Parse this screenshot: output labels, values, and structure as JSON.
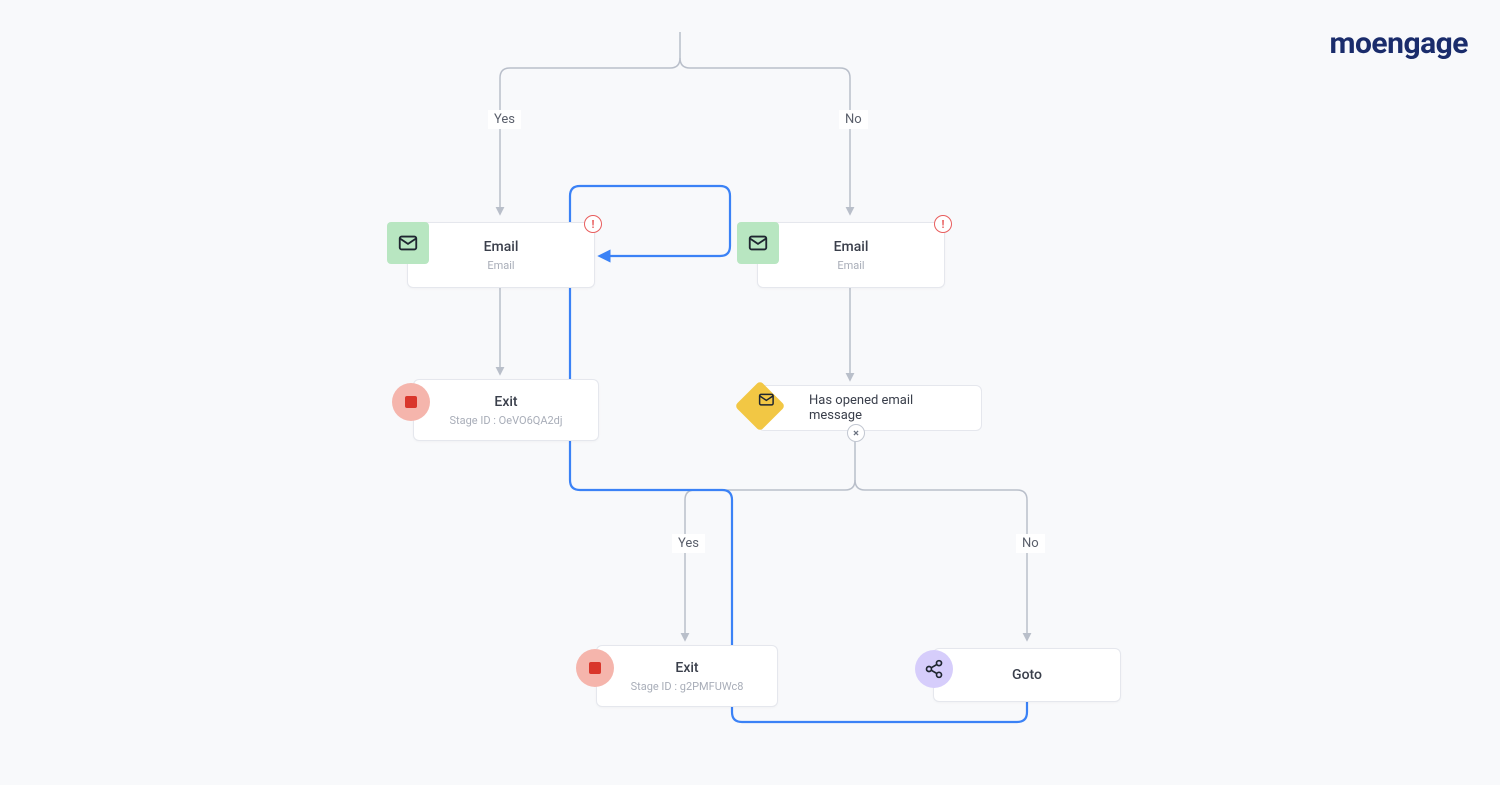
{
  "brand": "moengage",
  "branch1": {
    "yes": "Yes",
    "no": "No"
  },
  "branch2": {
    "yes": "Yes",
    "no": "No"
  },
  "email_left": {
    "title": "Email",
    "sub": "Email"
  },
  "email_right": {
    "title": "Email",
    "sub": "Email"
  },
  "exit_left": {
    "title": "Exit",
    "sub": "Stage ID : OeVO6QA2dj"
  },
  "condition": {
    "title": "Has opened email message"
  },
  "exit_bottom": {
    "title": "Exit",
    "sub": "Stage ID : g2PMFUWc8"
  },
  "goto": {
    "title": "Goto"
  },
  "alert_glyph": "!"
}
